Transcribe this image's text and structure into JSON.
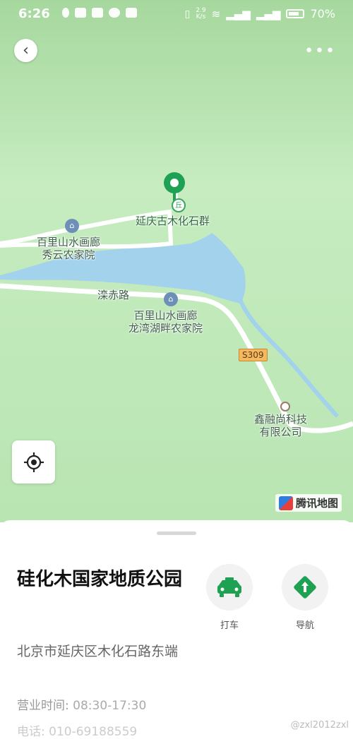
{
  "status_bar": {
    "time": "6:26",
    "net_speed_value": "2.9",
    "net_speed_unit": "K/s",
    "battery": "70%"
  },
  "map": {
    "poi_main": "延庆古木化石群",
    "poi_hotel1": [
      "百里山水画廊",
      "秀云农家院"
    ],
    "poi_hotel2": [
      "百里山水画廊",
      "龙湾湖畔农家院"
    ],
    "road_name": "滦赤路",
    "road_shield": "S309",
    "poi_company": [
      "鑫融尚科技",
      "有限公司"
    ],
    "brand": "腾讯地图",
    "park_marker": "丘"
  },
  "sheet": {
    "title": "硅化木国家地质公园",
    "address": "北京市延庆区木化石路东端",
    "hours_label": "营业时间: ",
    "hours_value": "08:30-17:30",
    "phone_partial": "电话: 010-69188559",
    "actions": [
      {
        "label": "打车",
        "icon": "taxi-icon"
      },
      {
        "label": "导航",
        "icon": "navigation-icon"
      }
    ]
  },
  "watermark": "@zxl2012zxl",
  "colors": {
    "map_green": "#bfe8b8",
    "water": "#a3d2ec",
    "accent_green": "#1fa153"
  }
}
